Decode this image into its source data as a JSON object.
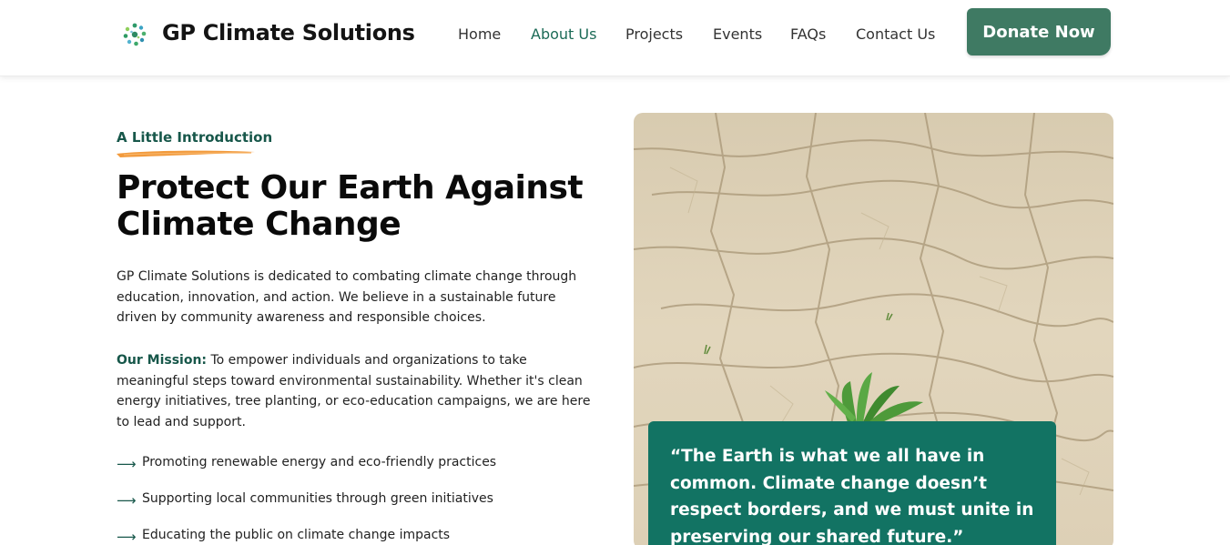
{
  "header": {
    "brand": "GP Climate Solutions",
    "logo_icon": "leaf-circle-logo-icon",
    "nav": [
      {
        "label": "Home",
        "active": false
      },
      {
        "label": "About Us",
        "active": true
      },
      {
        "label": "Projects",
        "active": false
      },
      {
        "label": "Events",
        "active": false
      },
      {
        "label": "FAQs",
        "active": false
      },
      {
        "label": "Contact Us",
        "active": false
      }
    ],
    "donate_label": "Donate Now"
  },
  "intro": {
    "eyebrow": "A Little Introduction",
    "title_line1": "Protect Our Earth Against",
    "title_line2": "Climate Change",
    "paragraph": "GP Climate Solutions is dedicated to combating climate change through education, innovation, and action. We believe in a sustainable future driven by community awareness and responsible choices.",
    "mission_label": "Our Mission:",
    "mission_text": " To empower individuals and organizations to take meaningful steps toward environmental sustainability. Whether it's clean energy initiatives, tree planting, or eco-education campaigns, we are here to lead and support.",
    "list_icon": "arrow-right-icon",
    "list": [
      "Promoting renewable energy and eco-friendly practices",
      "Supporting local communities through green initiatives",
      "Educating the public on climate change impacts"
    ]
  },
  "quote": {
    "text": "“The Earth is what we all have in common. Climate change doesn’t respect borders, and we must unite in preserving our shared future.”"
  },
  "colors": {
    "brand_green": "#3f7a63",
    "accent_teal": "#127363",
    "heading_green": "#17574a",
    "swoosh_orange": "#f29a3c"
  }
}
